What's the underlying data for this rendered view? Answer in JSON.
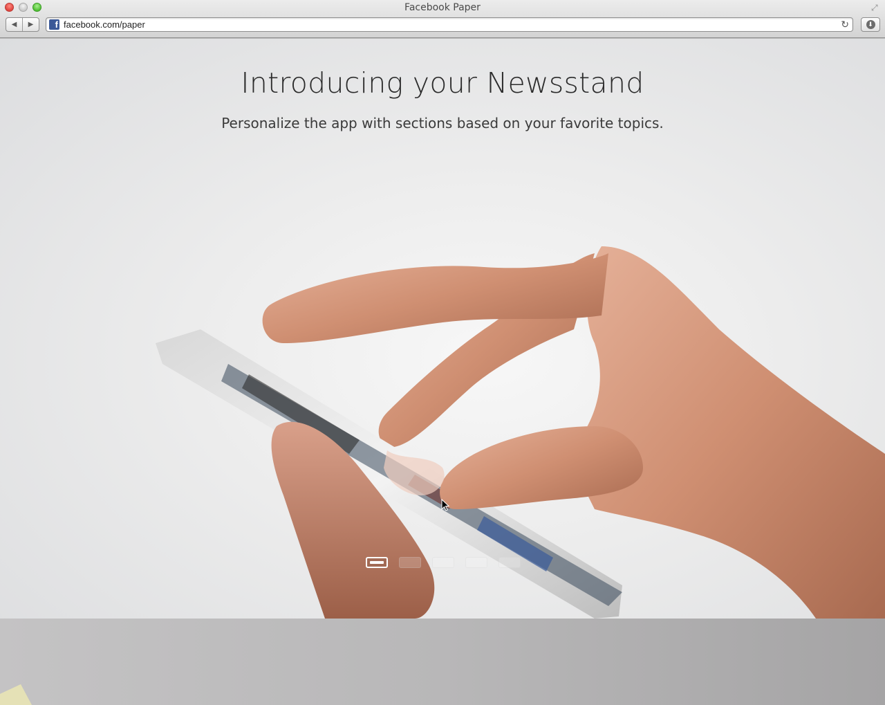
{
  "window": {
    "title": "Facebook Paper",
    "traffic_lights": [
      "close",
      "minimize",
      "zoom"
    ]
  },
  "toolbar": {
    "back_icon": "back-arrow-icon",
    "forward_icon": "forward-arrow-icon",
    "url": "facebook.com/paper",
    "favicon": "facebook-icon",
    "reload_icon": "reload-icon",
    "download_icon": "download-icon"
  },
  "hero": {
    "title": "Introducing your Newsstand",
    "subtitle": "Personalize the app with sections based on your favorite topics.",
    "illustration": "hand-holding-phone-image"
  },
  "carousel": {
    "count": 5,
    "active_index": 0
  },
  "colors": {
    "facebook_blue": "#3b5998",
    "close": "#e0443e",
    "zoom": "#4fbf33"
  }
}
